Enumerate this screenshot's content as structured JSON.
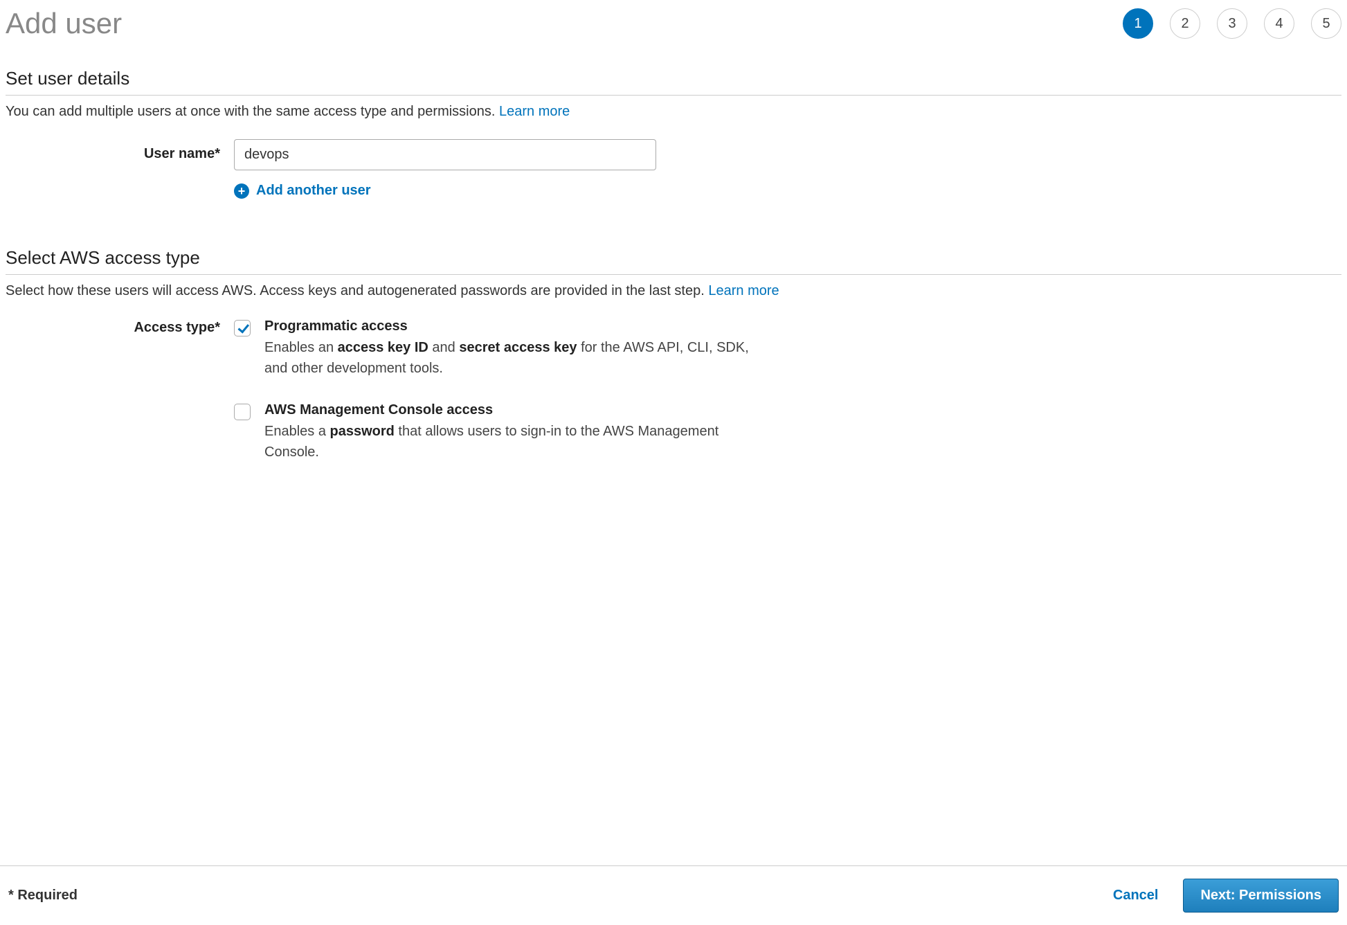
{
  "page": {
    "title": "Add user"
  },
  "steps": {
    "labels": [
      "1",
      "2",
      "3",
      "4",
      "5"
    ],
    "active_index": 0
  },
  "user_details": {
    "section_title": "Set user details",
    "description": "You can add multiple users at once with the same access type and permissions.",
    "learn_more": "Learn more",
    "username_label": "User name*",
    "username_value": "devops",
    "add_another_label": "Add another user"
  },
  "access_type": {
    "section_title": "Select AWS access type",
    "description": "Select how these users will access AWS. Access keys and autogenerated passwords are provided in the last step.",
    "learn_more": "Learn more",
    "label": "Access type*",
    "options": [
      {
        "title": "Programmatic access",
        "checked": true,
        "desc_prefix": "Enables an ",
        "desc_bold1": "access key ID",
        "desc_mid": " and ",
        "desc_bold2": "secret access key",
        "desc_suffix": " for the AWS API, CLI, SDK, and other development tools."
      },
      {
        "title": "AWS Management Console access",
        "checked": false,
        "desc_prefix": "Enables a ",
        "desc_bold1": "password",
        "desc_mid": "",
        "desc_bold2": "",
        "desc_suffix": " that allows users to sign-in to the AWS Management Console."
      }
    ]
  },
  "footer": {
    "required_note": "* Required",
    "cancel": "Cancel",
    "next": "Next: Permissions"
  }
}
